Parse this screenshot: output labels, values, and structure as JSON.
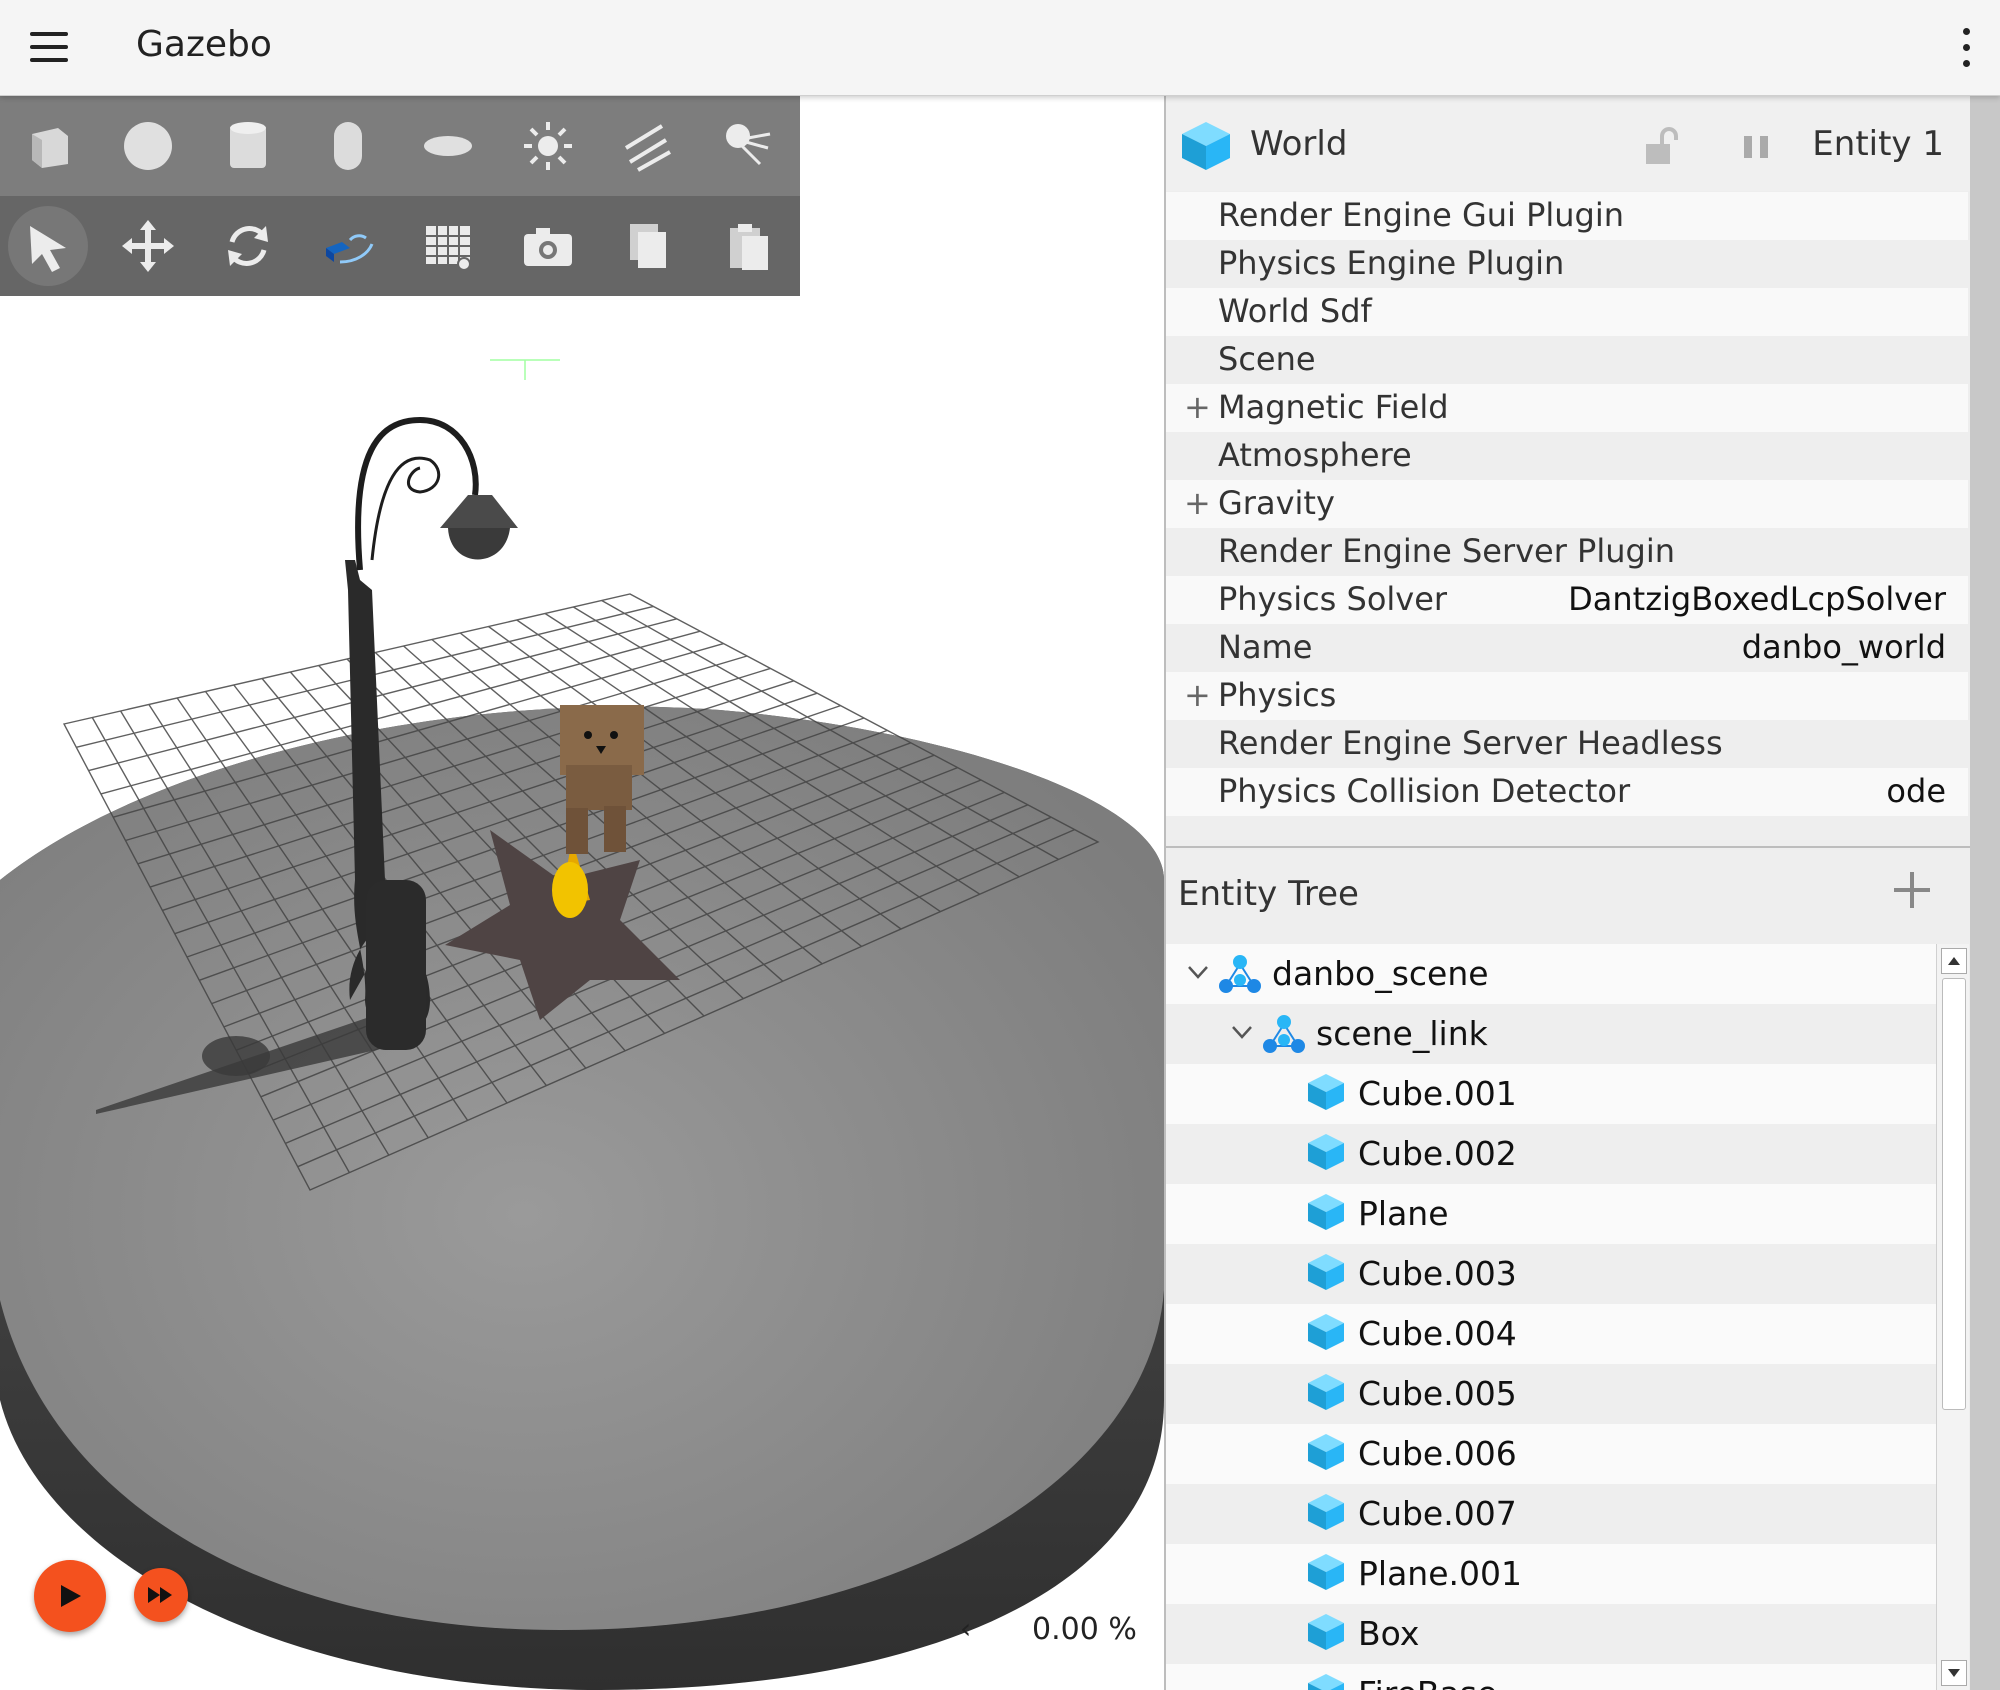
{
  "app": {
    "title": "Gazebo"
  },
  "toolbar": {
    "shapes": [
      "box-icon",
      "sphere-icon",
      "cylinder-icon",
      "capsule-icon",
      "ellipsoid-icon",
      "sun-light-icon",
      "directional-light-icon",
      "spot-light-icon"
    ],
    "transforms": [
      "select-icon",
      "translate-icon",
      "rotate-icon",
      "view-angle-icon",
      "grid-snap-icon",
      "screenshot-icon",
      "copy-icon",
      "paste-icon"
    ]
  },
  "playback": {
    "rtf_collapse": "‹",
    "rtf_value": "0.00 %"
  },
  "component_inspector": {
    "title": "World",
    "entity": "Entity 1",
    "rows": [
      {
        "name": "Render Engine Gui Plugin",
        "value": "",
        "expandable": false
      },
      {
        "name": "Physics Engine Plugin",
        "value": "",
        "expandable": false
      },
      {
        "name": "World Sdf",
        "value": "",
        "expandable": false
      },
      {
        "name": "Scene",
        "value": "",
        "expandable": false
      },
      {
        "name": "Magnetic Field",
        "value": "",
        "expandable": true
      },
      {
        "name": "Atmosphere",
        "value": "",
        "expandable": false
      },
      {
        "name": "Gravity",
        "value": "",
        "expandable": true
      },
      {
        "name": "Render Engine Server Plugin",
        "value": "",
        "expandable": false
      },
      {
        "name": "Physics Solver",
        "value": "DantzigBoxedLcpSolver",
        "expandable": false
      },
      {
        "name": "Name",
        "value": "danbo_world",
        "expandable": false
      },
      {
        "name": "Physics",
        "value": "",
        "expandable": true
      },
      {
        "name": "Render Engine Server Headless",
        "value": "",
        "expandable": false
      },
      {
        "name": "Physics Collision Detector",
        "value": "ode",
        "expandable": false
      }
    ]
  },
  "entity_tree": {
    "title": "Entity Tree",
    "items": [
      {
        "name": "danbo_scene",
        "level": 0,
        "kind": "model",
        "expanded": true
      },
      {
        "name": "scene_link",
        "level": 1,
        "kind": "link",
        "expanded": true
      },
      {
        "name": "Cube.001",
        "level": 2,
        "kind": "visual"
      },
      {
        "name": "Cube.002",
        "level": 2,
        "kind": "visual"
      },
      {
        "name": "Plane",
        "level": 2,
        "kind": "visual"
      },
      {
        "name": "Cube.003",
        "level": 2,
        "kind": "visual"
      },
      {
        "name": "Cube.004",
        "level": 2,
        "kind": "visual"
      },
      {
        "name": "Cube.005",
        "level": 2,
        "kind": "visual"
      },
      {
        "name": "Cube.006",
        "level": 2,
        "kind": "visual"
      },
      {
        "name": "Cube.007",
        "level": 2,
        "kind": "visual"
      },
      {
        "name": "Plane.001",
        "level": 2,
        "kind": "visual"
      },
      {
        "name": "Box",
        "level": 2,
        "kind": "visual"
      },
      {
        "name": "FireBase",
        "level": 2,
        "kind": "visual"
      }
    ]
  },
  "colors": {
    "accent": "#f4511e",
    "entity_cube": "#29b6f6",
    "toolbar": "#7d7d7d"
  }
}
